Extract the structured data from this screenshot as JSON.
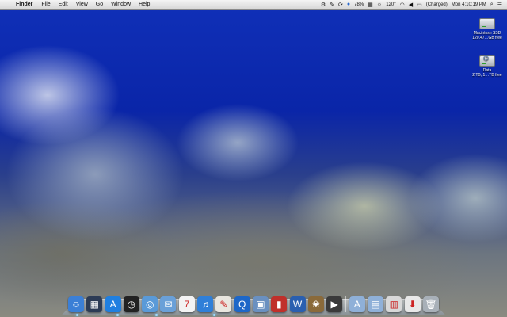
{
  "menubar": {
    "app_name": "Finder",
    "menus": [
      "File",
      "Edit",
      "View",
      "Go",
      "Window",
      "Help"
    ],
    "status": {
      "battery_percent": "78%",
      "temperature": "120°",
      "battery_state": "(Charged)",
      "clock": "Mon 4:10:19 PM"
    }
  },
  "desktop_icons": [
    {
      "name": "Macintosh SSD",
      "sub": "120.47…GB free"
    },
    {
      "name": "Data",
      "sub": "2 TB, 1…TB free"
    }
  ],
  "dock": {
    "calendar_day": "7",
    "items": [
      {
        "name": "finder",
        "color": "#3b7fd6",
        "glyph": "☺"
      },
      {
        "name": "dashboard",
        "color": "#2c3b55",
        "glyph": "▦"
      },
      {
        "name": "app-store",
        "color": "#1f7fe0",
        "glyph": "A"
      },
      {
        "name": "clock",
        "color": "#222",
        "glyph": "◷"
      },
      {
        "name": "safari",
        "color": "#5a9ad8",
        "glyph": "◎"
      },
      {
        "name": "mail",
        "color": "#6aa0d8",
        "glyph": "✉"
      },
      {
        "name": "calendar",
        "color": "#f3f3f3",
        "glyph": "7"
      },
      {
        "name": "itunes",
        "color": "#2f7fd8",
        "glyph": "♫"
      },
      {
        "name": "textedit",
        "color": "#e9e6df",
        "glyph": "✎"
      },
      {
        "name": "quicktime",
        "color": "#1d67c8",
        "glyph": "Q"
      },
      {
        "name": "preview",
        "color": "#6a90c0",
        "glyph": "▣"
      },
      {
        "name": "books",
        "color": "#c0302a",
        "glyph": "▮"
      },
      {
        "name": "word",
        "color": "#2a5fb0",
        "glyph": "W"
      },
      {
        "name": "iphoto",
        "color": "#8a6a3a",
        "glyph": "❀"
      },
      {
        "name": "facetime",
        "color": "#3a3a3a",
        "glyph": "▶"
      },
      {
        "name": "applications-folder",
        "color": "#8fb0d8",
        "glyph": "A"
      },
      {
        "name": "documents-folder",
        "color": "#8fb0d8",
        "glyph": "▤"
      },
      {
        "name": "downloads-stack",
        "color": "#d8d8d8",
        "glyph": "▥"
      },
      {
        "name": "download-folder",
        "color": "#e8e8e8",
        "glyph": "⬇"
      },
      {
        "name": "trash",
        "color": "#a8b0b8",
        "glyph": "🗑"
      }
    ]
  }
}
